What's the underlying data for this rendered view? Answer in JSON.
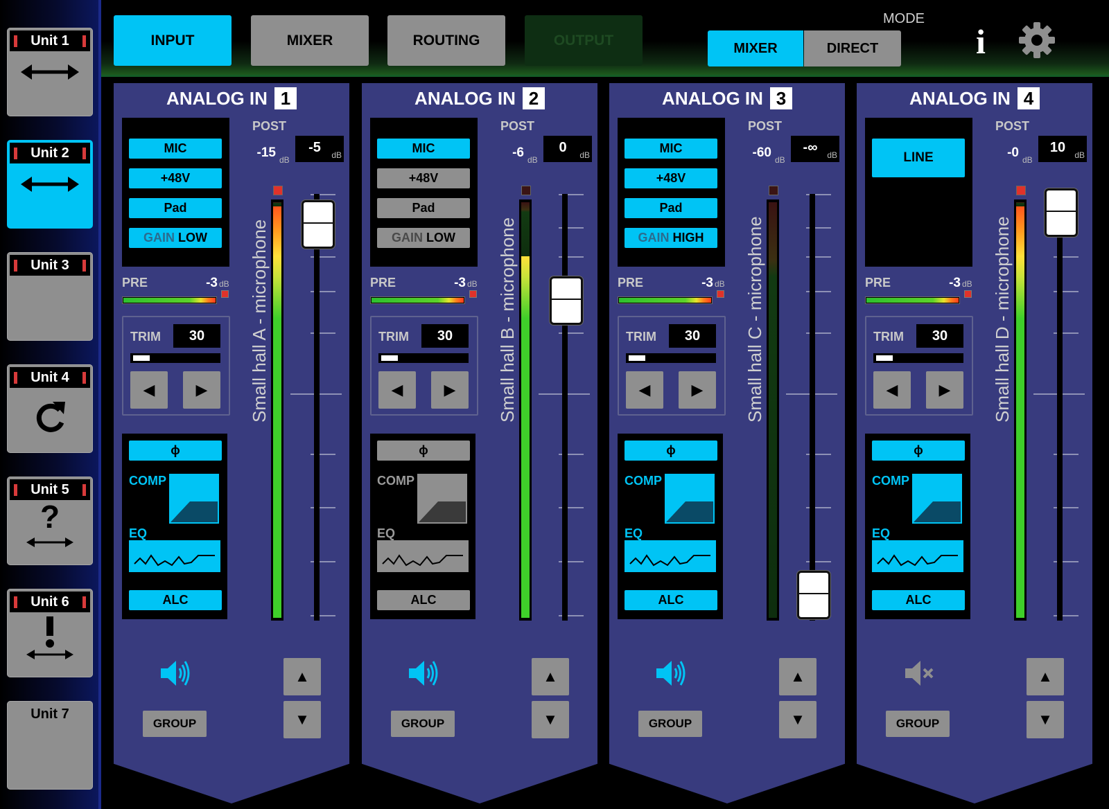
{
  "sidebar": {
    "units": [
      {
        "label": "Unit 1",
        "icon": "bidirectional-arrow-icon",
        "active": false
      },
      {
        "label": "Unit 2",
        "icon": "bidirectional-arrow-icon",
        "active": true
      },
      {
        "label": "Unit 3",
        "icon": "",
        "active": false
      },
      {
        "label": "Unit 4",
        "icon": "refresh-icon",
        "active": false
      },
      {
        "label": "Unit 5",
        "icon": "question-icon",
        "active": false
      },
      {
        "label": "Unit 6",
        "icon": "exclamation-icon",
        "active": false
      },
      {
        "label": "Unit 7",
        "icon": "",
        "active": false
      }
    ]
  },
  "tabs": {
    "input": "INPUT",
    "mixer": "MIXER",
    "routing": "ROUTING",
    "output": "OUTPUT"
  },
  "mode": {
    "label": "MODE",
    "mixer": "MIXER",
    "direct": "DIRECT",
    "selected": "MIXER"
  },
  "icons": {
    "info": "i",
    "settings": "gear-icon"
  },
  "colors": {
    "accent": "#00c4f5",
    "strip_bg": "#383b7e",
    "button_gray": "#8f8f8f",
    "clip_red": "#e0322a"
  },
  "channels": [
    {
      "title": "ANALOG IN",
      "number": "1",
      "name": "Small hall A - microphone",
      "source": "MIC",
      "phantom": "+48V",
      "pad": "Pad",
      "gain_label": "GAIN",
      "gain": "LOW",
      "phantom_on": true,
      "pad_on": true,
      "gain_on": true,
      "post_label": "POST",
      "pre_level": "-15",
      "post_level": "-5",
      "db": "dB",
      "pre_label": "PRE",
      "pre_peak": "-3",
      "trim_label": "TRIM",
      "trim": "30",
      "phase": "ɸ",
      "comp": "COMP",
      "eq": "EQ",
      "alc": "ALC",
      "proc_on": true,
      "group": "GROUP",
      "muted": false,
      "fader": 0.97,
      "meter": 0.99
    },
    {
      "title": "ANALOG IN",
      "number": "2",
      "name": "Small hall B - microphone",
      "source": "MIC",
      "phantom": "+48V",
      "pad": "Pad",
      "gain_label": "GAIN",
      "gain": "LOW",
      "phantom_on": false,
      "pad_on": false,
      "gain_on": false,
      "post_label": "POST",
      "pre_level": "-6",
      "post_level": "0",
      "db": "dB",
      "pre_label": "PRE",
      "pre_peak": "-3",
      "trim_label": "TRIM",
      "trim": "30",
      "phase": "ɸ",
      "comp": "COMP",
      "eq": "EQ",
      "alc": "ALC",
      "proc_on": false,
      "group": "GROUP",
      "muted": false,
      "fader": 0.77,
      "meter": 0.87
    },
    {
      "title": "ANALOG IN",
      "number": "3",
      "name": "Small hall C - microphone",
      "source": "MIC",
      "phantom": "+48V",
      "pad": "Pad",
      "gain_label": "GAIN",
      "gain": "HIGH",
      "phantom_on": true,
      "pad_on": true,
      "gain_on": true,
      "post_label": "POST",
      "pre_level": "-60",
      "post_level": "-∞",
      "db": "dB",
      "pre_label": "PRE",
      "pre_peak": "-3",
      "trim_label": "TRIM",
      "trim": "30",
      "phase": "ɸ",
      "comp": "COMP",
      "eq": "EQ",
      "alc": "ALC",
      "proc_on": true,
      "group": "GROUP",
      "muted": false,
      "fader": 0.0,
      "meter": 0.0
    },
    {
      "title": "ANALOG IN",
      "number": "4",
      "name": "Small hall D - microphone",
      "source": "LINE",
      "phantom": "",
      "pad": "",
      "gain_label": "",
      "gain": "",
      "phantom_on": false,
      "pad_on": false,
      "gain_on": false,
      "post_label": "POST",
      "pre_level": "-0",
      "post_level": "10",
      "db": "dB",
      "pre_label": "PRE",
      "pre_peak": "-3",
      "trim_label": "TRIM",
      "trim": "30",
      "phase": "ɸ",
      "comp": "COMP",
      "eq": "EQ",
      "alc": "ALC",
      "proc_on": true,
      "group": "GROUP",
      "muted": true,
      "fader": 1.0,
      "meter": 0.99
    }
  ]
}
